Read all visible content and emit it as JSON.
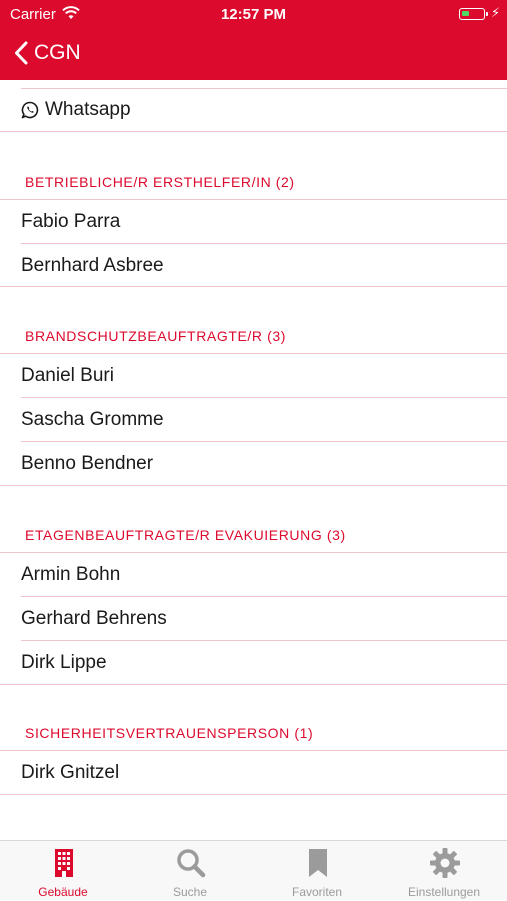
{
  "status_bar": {
    "carrier": "Carrier",
    "time": "12:57 PM"
  },
  "nav": {
    "back_label": "CGN"
  },
  "contact": {
    "whatsapp_label": "Whatsapp"
  },
  "sections": [
    {
      "title": "BETRIEBLICHE/R ERSTHELFER/IN (2)",
      "people": [
        "Fabio Parra",
        "Bernhard Asbree"
      ]
    },
    {
      "title": "BRANDSCHUTZBEAUFTRAGTE/R (3)",
      "people": [
        "Daniel Buri",
        "Sascha Gromme",
        "Benno Bendner"
      ]
    },
    {
      "title": "ETAGENBEAUFTRAGTE/R EVAKUIERUNG (3)",
      "people": [
        "Armin Bohn",
        "Gerhard Behrens",
        "Dirk Lippe"
      ]
    },
    {
      "title": "SICHERHEITSVERTRAUENSPERSON (1)",
      "people": [
        "Dirk Gnitzel"
      ]
    }
  ],
  "tabs": [
    {
      "label": "Gebäude",
      "icon": "building-icon"
    },
    {
      "label": "Suche",
      "icon": "search-icon"
    },
    {
      "label": "Favoriten",
      "icon": "bookmark-icon"
    },
    {
      "label": "Einstellungen",
      "icon": "gear-icon"
    }
  ],
  "colors": {
    "accent": "#dc0a2d",
    "separator": "#f1c3cb",
    "tab_inactive": "#9b9b9b"
  }
}
